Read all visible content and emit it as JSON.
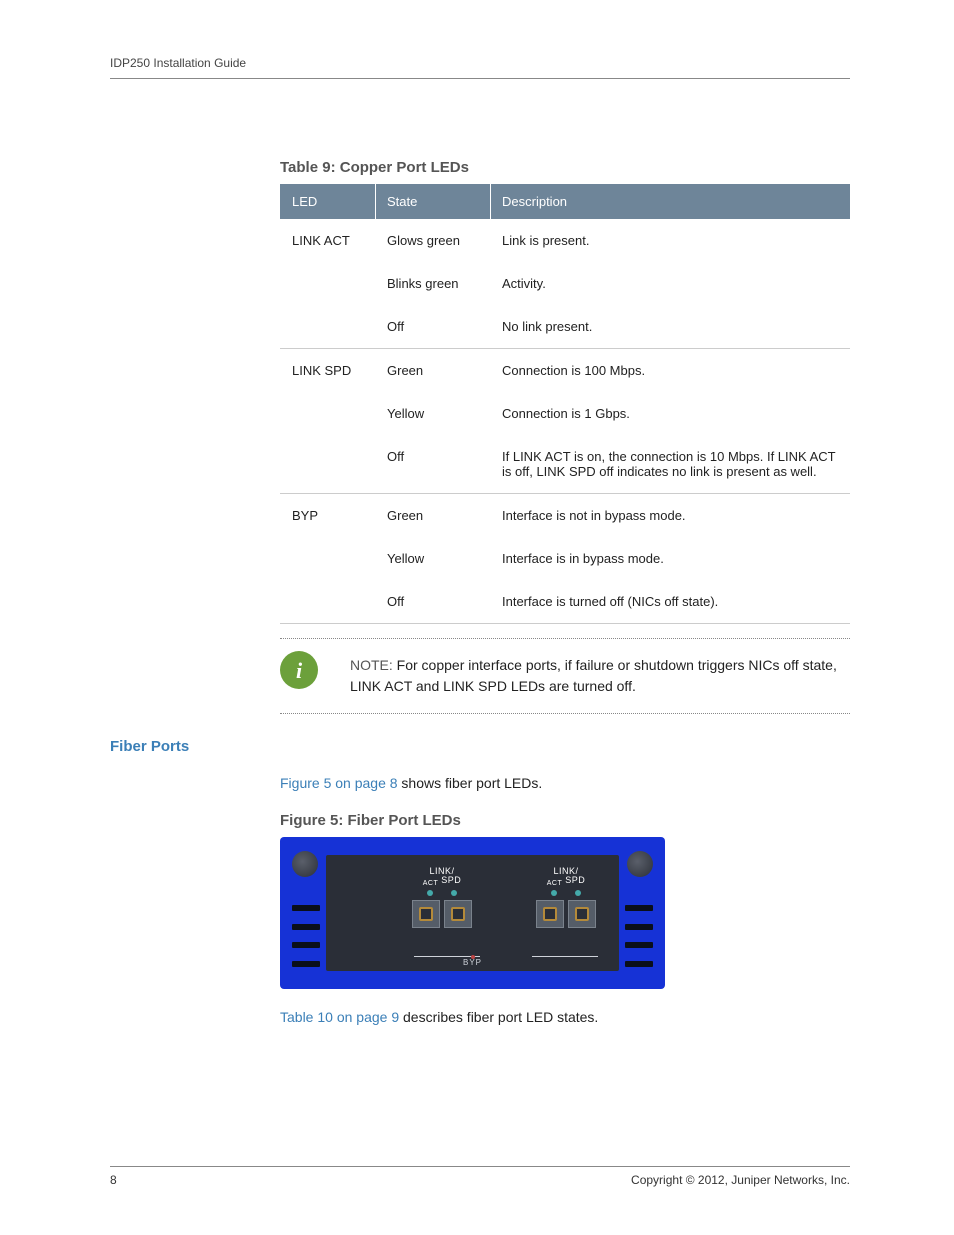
{
  "header": {
    "running_head": "IDP250 Installation Guide"
  },
  "table9": {
    "caption": "Table 9: Copper Port LEDs",
    "columns": {
      "c0": "LED",
      "c1": "State",
      "c2": "Description"
    },
    "rows": [
      {
        "led": "LINK ACT",
        "state": "Glows green",
        "desc": "Link is present."
      },
      {
        "led": "",
        "state": "Blinks green",
        "desc": "Activity."
      },
      {
        "led": "",
        "state": "Off",
        "desc": "No link present."
      },
      {
        "led": "LINK SPD",
        "state": "Green",
        "desc": "Connection is 100 Mbps."
      },
      {
        "led": "",
        "state": "Yellow",
        "desc": "Connection is 1 Gbps."
      },
      {
        "led": "",
        "state": "Off",
        "desc": "If LINK ACT is on, the connection is 10 Mbps. If LINK ACT is off, LINK SPD off indicates no link is present as well."
      },
      {
        "led": "BYP",
        "state": "Green",
        "desc": "Interface is not in bypass mode."
      },
      {
        "led": "",
        "state": "Yellow",
        "desc": "Interface is in bypass mode."
      },
      {
        "led": "",
        "state": "Off",
        "desc": "Interface is turned off (NICs off state)."
      }
    ]
  },
  "note": {
    "label": "NOTE:",
    "text": "For copper interface ports, if failure or shutdown triggers NICs off state, LINK ACT and LINK SPD LEDs are turned off."
  },
  "section": {
    "heading": "Fiber Ports"
  },
  "para1": {
    "link": "Figure 5 on page 8",
    "rest": " shows fiber port LEDs."
  },
  "figure5": {
    "caption": "Figure 5: Fiber Port LEDs",
    "label_linkact": "LINK/",
    "label_act": "ACT",
    "label_spd": "SPD",
    "label_byp": "BYP"
  },
  "para2": {
    "link": "Table 10 on page 9",
    "rest": " describes fiber port LED states."
  },
  "footer": {
    "page": "8",
    "copyright": "Copyright © 2012, Juniper Networks, Inc."
  }
}
